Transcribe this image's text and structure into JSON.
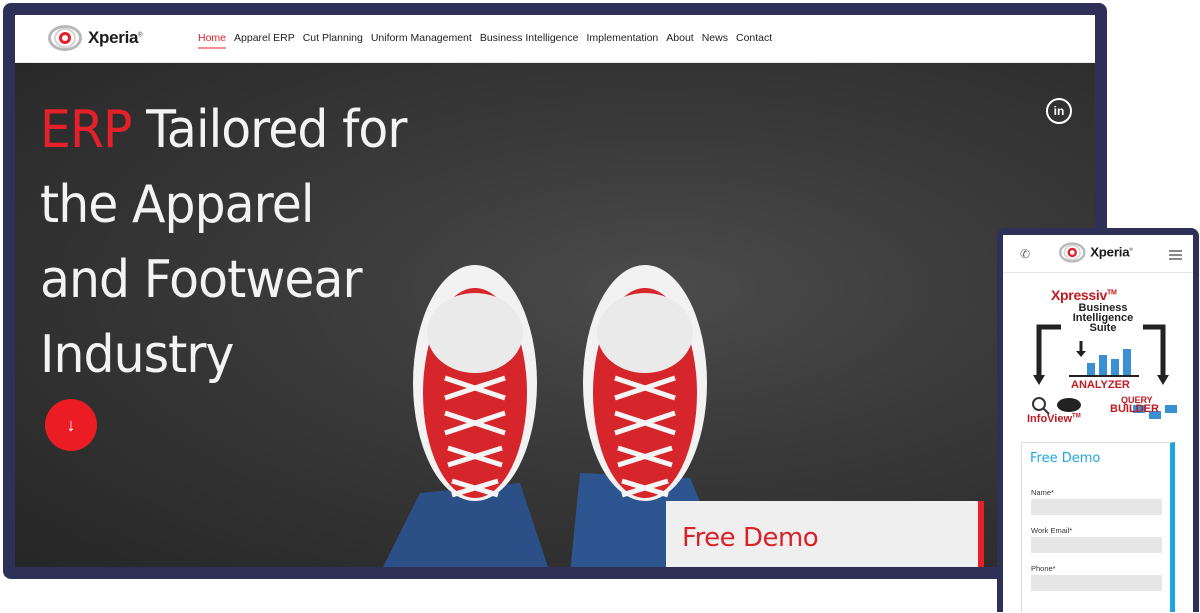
{
  "desktop": {
    "logo": {
      "text": "Xperia",
      "tm": "®"
    },
    "nav": {
      "items": [
        {
          "label": "Home",
          "active": true
        },
        {
          "label": "Apparel ERP",
          "active": false
        },
        {
          "label": "Cut Planning",
          "active": false
        },
        {
          "label": "Uniform Management",
          "active": false
        },
        {
          "label": "Business Intelligence",
          "active": false
        },
        {
          "label": "Implementation",
          "active": false
        },
        {
          "label": "About",
          "active": false
        },
        {
          "label": "News",
          "active": false
        },
        {
          "label": "Contact",
          "active": false
        }
      ]
    },
    "hero": {
      "title_accent": "ERP",
      "title_rest": " Tailored for the Apparel and Footwear Industry",
      "scroll_icon": "↓",
      "social_icon": "in"
    },
    "demo_panel": {
      "title": "Free Demo"
    }
  },
  "mobile": {
    "logo": {
      "text": "Xperia",
      "tm": "®"
    },
    "phone_icon": "✆",
    "bi": {
      "title": "Xpressiv",
      "title_tm": "TM",
      "subtitle": "Business Intelligence Suite",
      "analyzer": "ANALYZER",
      "infoview": "InfoView",
      "infoview_tm": "TM",
      "query": "QUERY",
      "builder": "BUILDER"
    },
    "form": {
      "title": "Free Demo",
      "fields": [
        {
          "label": "Name*"
        },
        {
          "label": "Work Email*"
        },
        {
          "label": "Phone*"
        }
      ]
    }
  },
  "colors": {
    "accent_red": "#e5202a",
    "frame": "#2f3058",
    "mobile_accent": "#1fa6e0"
  }
}
